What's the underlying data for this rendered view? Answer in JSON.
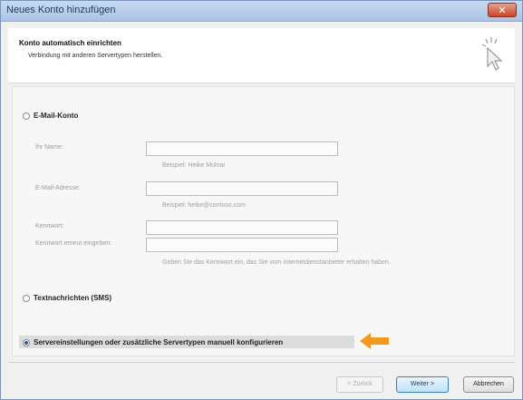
{
  "window": {
    "title": "Neues Konto hinzufügen",
    "close_label": "✕"
  },
  "header": {
    "title": "Konto automatisch einrichten",
    "subtitle": "Verbindung mit anderen Servertypen herstellen."
  },
  "options": {
    "email": {
      "label": "E-Mail-Konto",
      "selected": false
    },
    "sms": {
      "label": "Textnachrichten (SMS)",
      "selected": false
    },
    "manual": {
      "label": "Servereinstellungen oder zusätzliche Servertypen manuell konfigurieren",
      "selected": true
    }
  },
  "form": {
    "name": {
      "label": "Ihr Name:",
      "value": "",
      "hint": "Beispiel: Heike Molnar"
    },
    "email": {
      "label": "E-Mail-Adresse:",
      "value": "",
      "hint": "Beispiel: heike@contoso.com"
    },
    "password": {
      "label": "Kennwort:",
      "value": ""
    },
    "password_confirm": {
      "label": "Kennwort erneut eingeben:",
      "value": ""
    },
    "password_hint": "Geben Sie das Kennwort ein, das Sie vom Internetdienstanbieter erhalten haben."
  },
  "buttons": {
    "back": "< Zurück",
    "next": "Weiter >",
    "cancel": "Abbrechen"
  },
  "colors": {
    "arrow": "#f39a1e",
    "titlebar": "#b5cbe9"
  },
  "icons": {
    "cursor": "cursor-icon",
    "arrow": "arrow-icon"
  }
}
